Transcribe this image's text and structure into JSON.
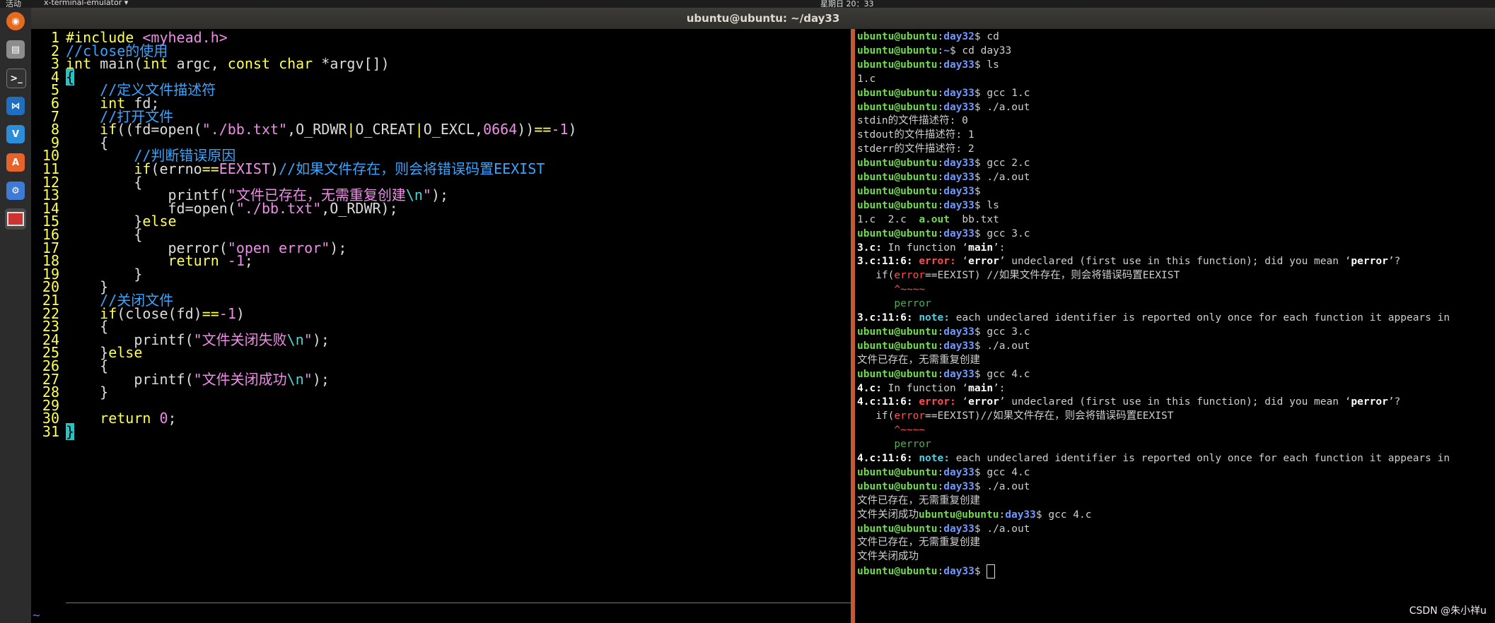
{
  "top_bar": {
    "activities": "活动",
    "app_menu": "x-terminal-emulator ▾",
    "clock": "星期日 20：33"
  },
  "window": {
    "title": "ubuntu@ubuntu: ~/day33"
  },
  "dock": {
    "items": [
      "firefox-icon",
      "files-icon",
      "terminal-icon",
      "vscode-icon",
      "vscode-alt-icon",
      "software-center-icon",
      "settings-icon",
      "terminal-emulator-icon"
    ]
  },
  "vim": {
    "lines": [
      [
        {
          "t": "#include ",
          "c": "k"
        },
        {
          "t": "<myhead.h>",
          "c": "s"
        }
      ],
      [
        {
          "t": "//close的使用",
          "c": "c"
        }
      ],
      [
        {
          "t": "int",
          "c": "k"
        },
        {
          "t": " main("
        },
        {
          "t": "int",
          "c": "k"
        },
        {
          "t": " argc, "
        },
        {
          "t": "const",
          "c": "k"
        },
        {
          "t": " "
        },
        {
          "t": "char",
          "c": "k"
        },
        {
          "t": " *argv[])"
        }
      ],
      [
        {
          "t": "{",
          "c": "cur"
        }
      ],
      [
        {
          "t": "    "
        },
        {
          "t": "//定义文件描述符",
          "c": "c"
        }
      ],
      [
        {
          "t": "    "
        },
        {
          "t": "int",
          "c": "k"
        },
        {
          "t": " fd;"
        }
      ],
      [
        {
          "t": "    "
        },
        {
          "t": "//打开文件",
          "c": "c"
        }
      ],
      [
        {
          "t": "    "
        },
        {
          "t": "if",
          "c": "k"
        },
        {
          "t": "((fd=open("
        },
        {
          "t": "\"./bb.txt\"",
          "c": "s"
        },
        {
          "t": ",O_RDWR"
        },
        {
          "t": "|",
          "c": "k"
        },
        {
          "t": "O_CREAT"
        },
        {
          "t": "|",
          "c": "k"
        },
        {
          "t": "O_EXCL,"
        },
        {
          "t": "0664",
          "c": "s"
        },
        {
          "t": "))"
        },
        {
          "t": "==",
          "c": "k"
        },
        {
          "t": "-1",
          "c": "s"
        },
        {
          "t": ")"
        }
      ],
      [
        {
          "t": "    {"
        }
      ],
      [
        {
          "t": "        "
        },
        {
          "t": "//判断错误原因",
          "c": "c"
        }
      ],
      [
        {
          "t": "        "
        },
        {
          "t": "if",
          "c": "k"
        },
        {
          "t": "(errno"
        },
        {
          "t": "==",
          "c": "k"
        },
        {
          "t": "EEXIST",
          "c": "s"
        },
        {
          "t": ")"
        },
        {
          "t": "//如果文件存在，则会将错误码置EEXIST",
          "c": "c"
        }
      ],
      [
        {
          "t": "        {"
        }
      ],
      [
        {
          "t": "            printf("
        },
        {
          "t": "\"文件已存在，无需重复创建",
          "c": "s"
        },
        {
          "t": "\\n",
          "c": "t"
        },
        {
          "t": "\"",
          "c": "s"
        },
        {
          "t": ");"
        }
      ],
      [
        {
          "t": "            fd=open("
        },
        {
          "t": "\"./bb.txt\"",
          "c": "s"
        },
        {
          "t": ",O_RDWR);"
        }
      ],
      [
        {
          "t": "        }"
        },
        {
          "t": "else",
          "c": "k"
        }
      ],
      [
        {
          "t": "        {"
        }
      ],
      [
        {
          "t": "            perror("
        },
        {
          "t": "\"open error\"",
          "c": "s"
        },
        {
          "t": ");"
        }
      ],
      [
        {
          "t": "            "
        },
        {
          "t": "return",
          "c": "k"
        },
        {
          "t": " "
        },
        {
          "t": "-1",
          "c": "s"
        },
        {
          "t": ";"
        }
      ],
      [
        {
          "t": "        }"
        }
      ],
      [
        {
          "t": "    }"
        }
      ],
      [
        {
          "t": "    "
        },
        {
          "t": "//关闭文件",
          "c": "c"
        }
      ],
      [
        {
          "t": "    "
        },
        {
          "t": "if",
          "c": "k"
        },
        {
          "t": "(close(fd)"
        },
        {
          "t": "==",
          "c": "k"
        },
        {
          "t": "-1",
          "c": "s"
        },
        {
          "t": ")"
        }
      ],
      [
        {
          "t": "    {"
        }
      ],
      [
        {
          "t": "        printf("
        },
        {
          "t": "\"文件关闭失败",
          "c": "s"
        },
        {
          "t": "\\n",
          "c": "t"
        },
        {
          "t": "\"",
          "c": "s"
        },
        {
          "t": ");"
        }
      ],
      [
        {
          "t": "    }"
        },
        {
          "t": "else",
          "c": "k"
        }
      ],
      [
        {
          "t": "    {"
        }
      ],
      [
        {
          "t": "        printf("
        },
        {
          "t": "\"文件关闭成功",
          "c": "s"
        },
        {
          "t": "\\n",
          "c": "t"
        },
        {
          "t": "\"",
          "c": "s"
        },
        {
          "t": ");"
        }
      ],
      [
        {
          "t": "    }"
        }
      ],
      [],
      [
        {
          "t": "    "
        },
        {
          "t": "return",
          "c": "k"
        },
        {
          "t": " "
        },
        {
          "t": "0",
          "c": "s"
        },
        {
          "t": ";"
        }
      ],
      [
        {
          "t": "}",
          "c": "cur"
        }
      ]
    ],
    "tilde": "~"
  },
  "terminal": {
    "lines": [
      [
        {
          "t": "ubuntu@ubuntu",
          "c": "ug"
        },
        {
          "t": ":"
        },
        {
          "t": "day32",
          "c": "ub"
        },
        {
          "t": "$ cd"
        }
      ],
      [
        {
          "t": "ubuntu@ubuntu",
          "c": "ug"
        },
        {
          "t": ":"
        },
        {
          "t": "~",
          "c": "ub"
        },
        {
          "t": "$ cd day33"
        }
      ],
      [
        {
          "t": "ubuntu@ubuntu",
          "c": "ug"
        },
        {
          "t": ":"
        },
        {
          "t": "day33",
          "c": "ub"
        },
        {
          "t": "$ ls"
        }
      ],
      [
        {
          "t": "1.c"
        }
      ],
      [
        {
          "t": "ubuntu@ubuntu",
          "c": "ug"
        },
        {
          "t": ":"
        },
        {
          "t": "day33",
          "c": "ub"
        },
        {
          "t": "$ gcc 1.c"
        }
      ],
      [
        {
          "t": "ubuntu@ubuntu",
          "c": "ug"
        },
        {
          "t": ":"
        },
        {
          "t": "day33",
          "c": "ub"
        },
        {
          "t": "$ ./a.out"
        }
      ],
      [
        {
          "t": "stdin的文件描述符: 0"
        }
      ],
      [
        {
          "t": "stdout的文件描述符: 1"
        }
      ],
      [
        {
          "t": "stderr的文件描述符: 2"
        }
      ],
      [
        {
          "t": "ubuntu@ubuntu",
          "c": "ug"
        },
        {
          "t": ":"
        },
        {
          "t": "day33",
          "c": "ub"
        },
        {
          "t": "$ gcc 2.c"
        }
      ],
      [
        {
          "t": "ubuntu@ubuntu",
          "c": "ug"
        },
        {
          "t": ":"
        },
        {
          "t": "day33",
          "c": "ub"
        },
        {
          "t": "$ ./a.out"
        }
      ],
      [
        {
          "t": "ubuntu@ubuntu",
          "c": "ug"
        },
        {
          "t": ":"
        },
        {
          "t": "day33",
          "c": "ub"
        },
        {
          "t": "$"
        }
      ],
      [
        {
          "t": "ubuntu@ubuntu",
          "c": "ug"
        },
        {
          "t": ":"
        },
        {
          "t": "day33",
          "c": "ub"
        },
        {
          "t": "$ ls"
        }
      ],
      [
        {
          "t": "1.c  2.c  "
        },
        {
          "t": "a.out",
          "c": "ug"
        },
        {
          "t": "  bb.txt"
        }
      ],
      [
        {
          "t": "ubuntu@ubuntu",
          "c": "ug"
        },
        {
          "t": ":"
        },
        {
          "t": "day33",
          "c": "ub"
        },
        {
          "t": "$ gcc 3.c"
        }
      ],
      [
        {
          "t": "3.c:",
          "c": "b"
        },
        {
          "t": " In function ‘"
        },
        {
          "t": "main",
          "c": "b"
        },
        {
          "t": "’:"
        }
      ],
      [
        {
          "t": "3.c:11:6: ",
          "c": "b"
        },
        {
          "t": "error: ",
          "c": "er"
        },
        {
          "t": "‘"
        },
        {
          "t": "error",
          "c": "b"
        },
        {
          "t": "’ undeclared (first use in this function); did you mean ‘"
        },
        {
          "t": "perror",
          "c": "b"
        },
        {
          "t": "’?"
        }
      ],
      [
        {
          "t": "   if("
        },
        {
          "t": "error",
          "c": "rd"
        },
        {
          "t": "==EEXIST) //如果文件存在，则会将错误码置EEXIST"
        }
      ],
      [
        {
          "t": "      ^~~~~",
          "c": "rd"
        }
      ],
      [
        {
          "t": "      perror",
          "c": "gr"
        }
      ],
      [
        {
          "t": "3.c:11:6: ",
          "c": "b"
        },
        {
          "t": "note: ",
          "c": "no"
        },
        {
          "t": "each undeclared identifier is reported only once for each function it appears in"
        }
      ],
      [
        {
          "t": "ubuntu@ubuntu",
          "c": "ug"
        },
        {
          "t": ":"
        },
        {
          "t": "day33",
          "c": "ub"
        },
        {
          "t": "$ gcc 3.c"
        }
      ],
      [
        {
          "t": "ubuntu@ubuntu",
          "c": "ug"
        },
        {
          "t": ":"
        },
        {
          "t": "day33",
          "c": "ub"
        },
        {
          "t": "$ ./a.out"
        }
      ],
      [
        {
          "t": "文件已存在，无需重复创建"
        }
      ],
      [
        {
          "t": "ubuntu@ubuntu",
          "c": "ug"
        },
        {
          "t": ":"
        },
        {
          "t": "day33",
          "c": "ub"
        },
        {
          "t": "$ gcc 4.c"
        }
      ],
      [
        {
          "t": "4.c:",
          "c": "b"
        },
        {
          "t": " In function ‘"
        },
        {
          "t": "main",
          "c": "b"
        },
        {
          "t": "’:"
        }
      ],
      [
        {
          "t": "4.c:11:6: ",
          "c": "b"
        },
        {
          "t": "error: ",
          "c": "er"
        },
        {
          "t": "‘"
        },
        {
          "t": "error",
          "c": "b"
        },
        {
          "t": "’ undeclared (first use in this function); did you mean ‘"
        },
        {
          "t": "perror",
          "c": "b"
        },
        {
          "t": "’?"
        }
      ],
      [
        {
          "t": "   if("
        },
        {
          "t": "error",
          "c": "rd"
        },
        {
          "t": "==EEXIST)//如果文件存在，则会将错误码置EEXIST"
        }
      ],
      [
        {
          "t": "      ^~~~~",
          "c": "rd"
        }
      ],
      [
        {
          "t": "      perror",
          "c": "gr"
        }
      ],
      [
        {
          "t": "4.c:11:6: ",
          "c": "b"
        },
        {
          "t": "note: ",
          "c": "no"
        },
        {
          "t": "each undeclared identifier is reported only once for each function it appears in"
        }
      ],
      [
        {
          "t": "ubuntu@ubuntu",
          "c": "ug"
        },
        {
          "t": ":"
        },
        {
          "t": "day33",
          "c": "ub"
        },
        {
          "t": "$ gcc 4.c"
        }
      ],
      [
        {
          "t": "ubuntu@ubuntu",
          "c": "ug"
        },
        {
          "t": ":"
        },
        {
          "t": "day33",
          "c": "ub"
        },
        {
          "t": "$ ./a.out"
        }
      ],
      [
        {
          "t": "文件已存在，无需重复创建"
        }
      ],
      [
        {
          "t": "文件关闭成功"
        },
        {
          "t": "ubuntu@ubuntu",
          "c": "ug"
        },
        {
          "t": ":"
        },
        {
          "t": "day33",
          "c": "ub"
        },
        {
          "t": "$ gcc 4.c"
        }
      ],
      [
        {
          "t": "ubuntu@ubuntu",
          "c": "ug"
        },
        {
          "t": ":"
        },
        {
          "t": "day33",
          "c": "ub"
        },
        {
          "t": "$ ./a.out"
        }
      ],
      [
        {
          "t": "文件已存在，无需重复创建"
        }
      ],
      [
        {
          "t": "文件关闭成功"
        }
      ],
      [
        {
          "t": "ubuntu@ubuntu",
          "c": "ug"
        },
        {
          "t": ":"
        },
        {
          "t": "day33",
          "c": "ub"
        },
        {
          "t": "$ "
        },
        {
          "t": "",
          "c": "cursor"
        }
      ]
    ]
  },
  "watermark": "CSDN @朱小祥u",
  "colors": {
    "prompt_user": "#6fda4c",
    "prompt_dir": "#6f98ff",
    "vim_keyword": "#ffff55",
    "vim_string": "#ef8ce8",
    "vim_comment": "#36a5ff",
    "divider": "#c35a35"
  }
}
